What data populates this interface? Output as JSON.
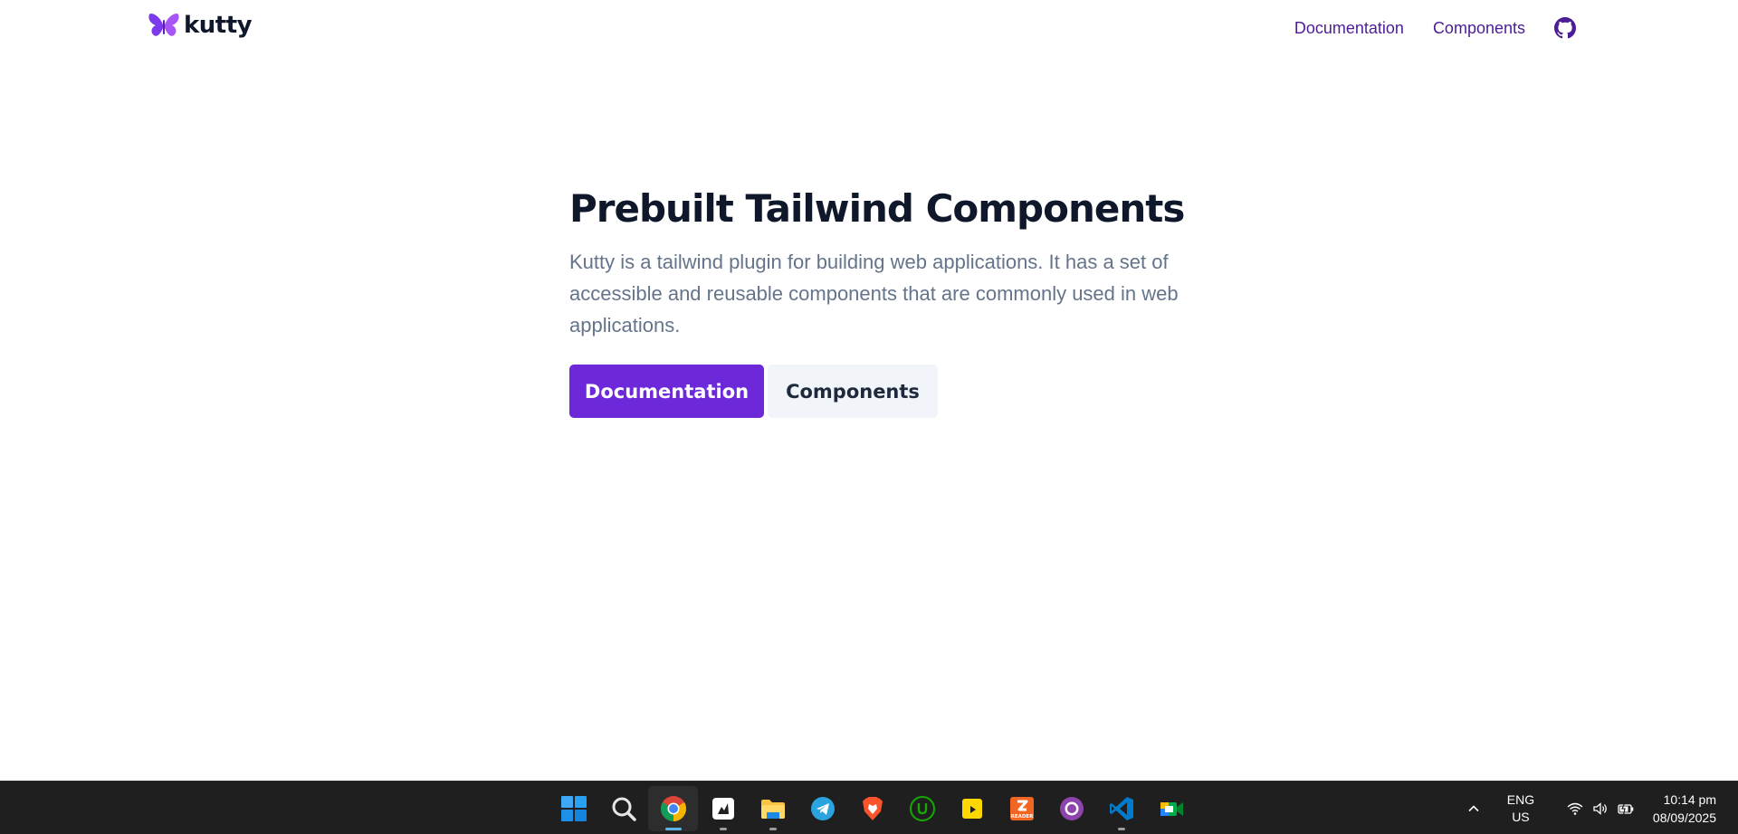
{
  "brand": {
    "name": "kutty",
    "accent": "#6d28d9",
    "text_color": "#0f172a",
    "nav_color": "#4c1d95"
  },
  "nav": {
    "documentation": "Documentation",
    "components": "Components",
    "github_icon": "github-icon"
  },
  "hero": {
    "title": "Prebuilt Tailwind Components",
    "description": "Kutty is a tailwind plugin for building web applications. It has a set of accessible and reusable components that are commonly used in web applications.",
    "primary_button": "Documentation",
    "secondary_button": "Components"
  },
  "taskbar": {
    "background": "#1f1f1f",
    "apps": [
      "windows-start-icon",
      "search-icon",
      "chrome-icon",
      "app-icon",
      "file-explorer-icon",
      "telegram-icon",
      "brave-icon",
      "upwork-icon",
      "sticky-app-icon",
      "reader-icon",
      "github-desktop-icon",
      "vscode-icon",
      "google-meet-icon"
    ],
    "reader_label": "READER",
    "tray": {
      "lang_line1": "ENG",
      "lang_line2": "US",
      "time": "10:14 pm",
      "date": "08/09/2025"
    }
  }
}
